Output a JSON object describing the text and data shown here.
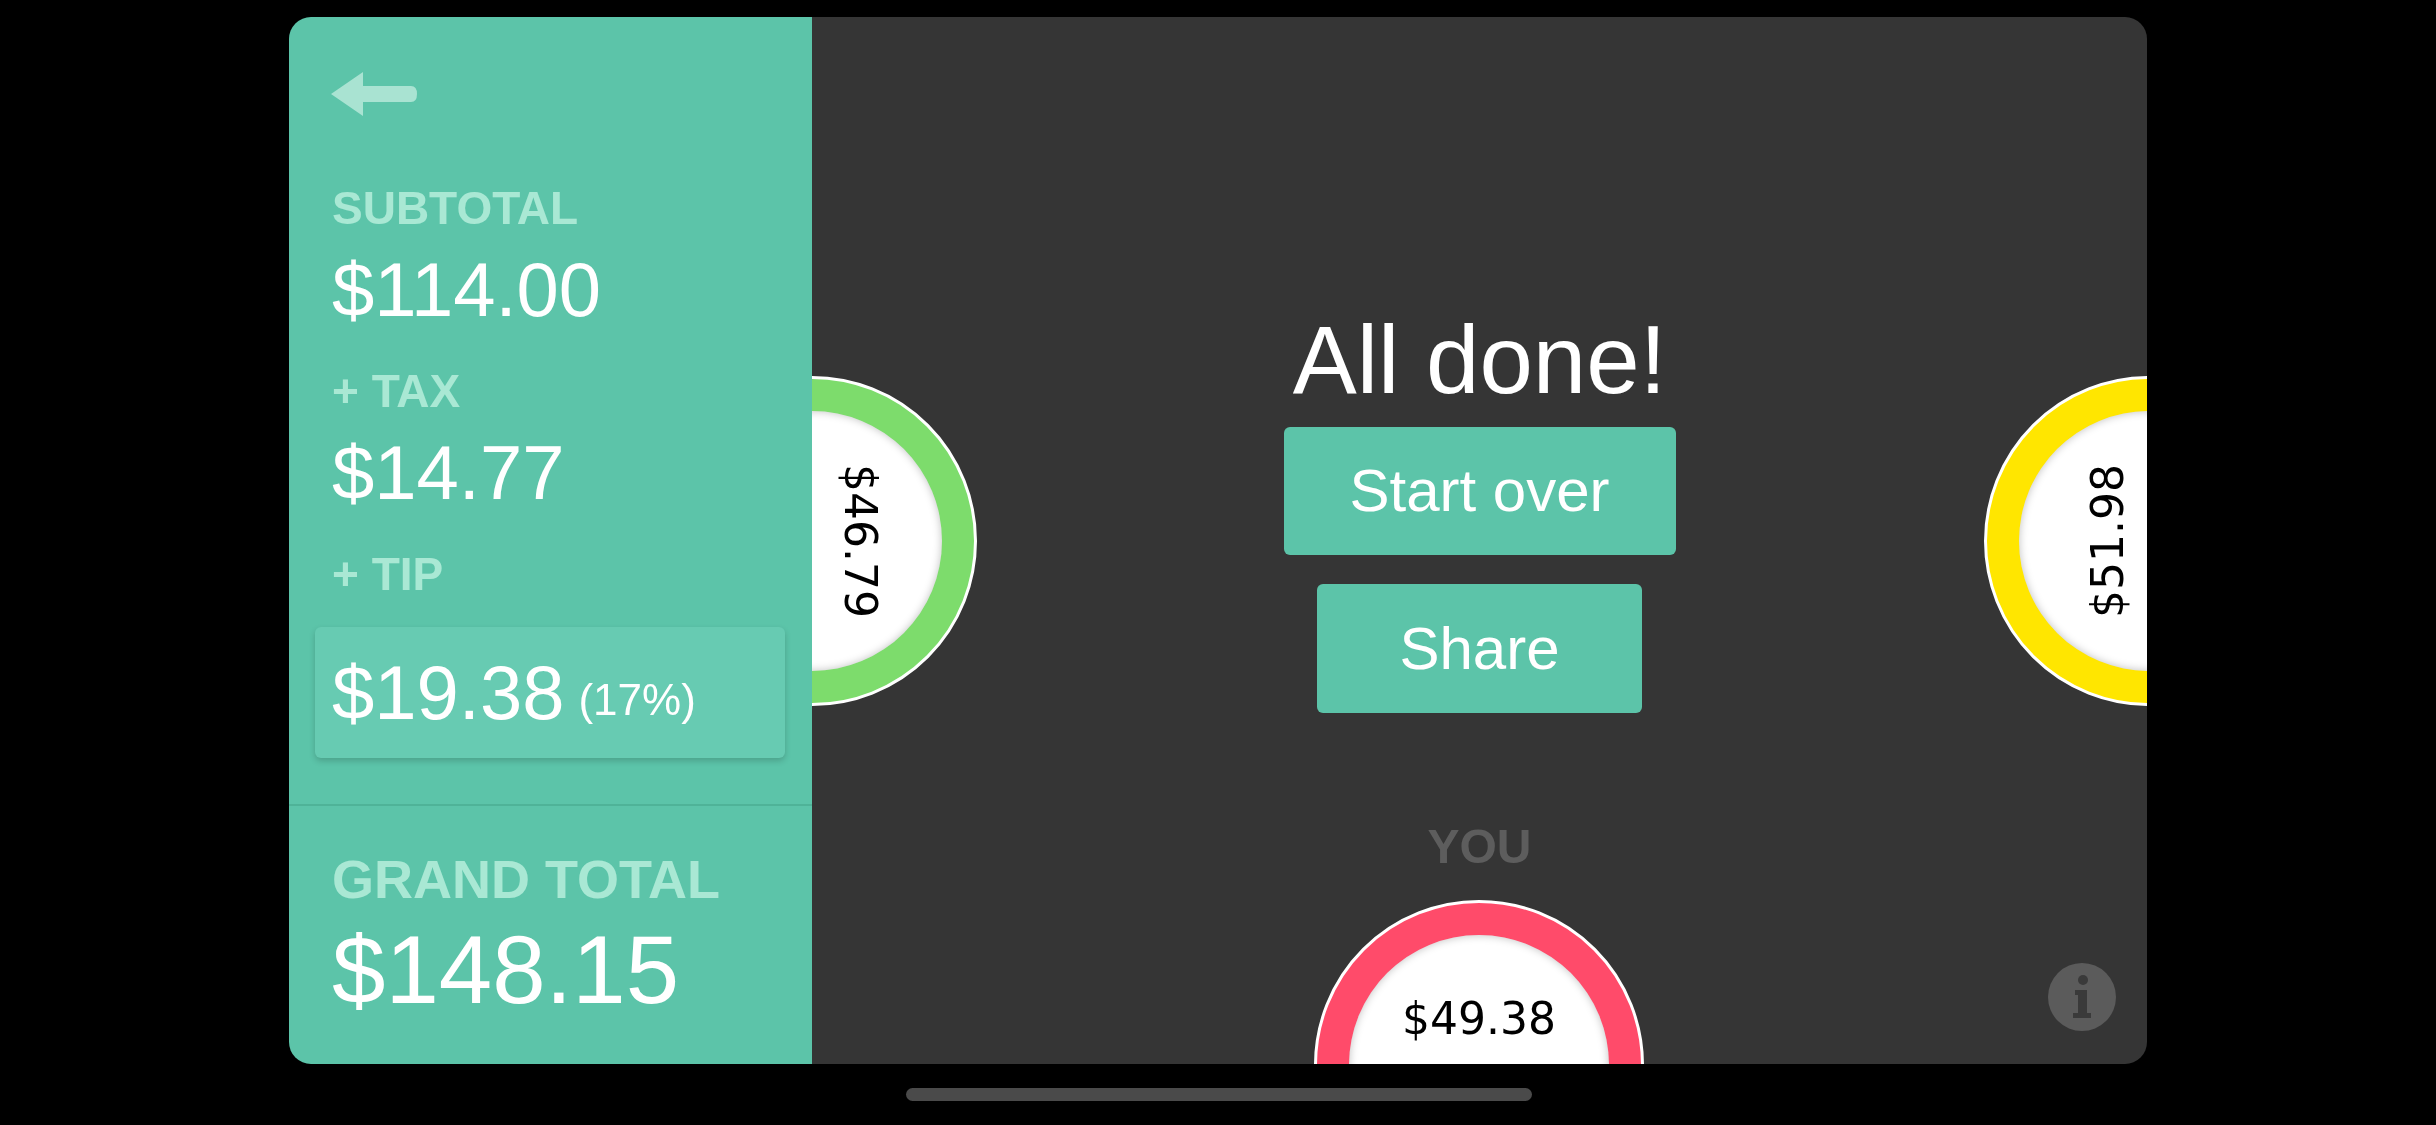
{
  "sidebar": {
    "subtotal": {
      "label": "SUBTOTAL",
      "value": "$114.00"
    },
    "tax": {
      "label": "+ TAX",
      "value": "$14.77"
    },
    "tip": {
      "label": "+ TIP",
      "value": "$19.38",
      "percent": "(17%)"
    },
    "grand_total": {
      "label": "GRAND TOTAL",
      "value": "$148.15"
    }
  },
  "main": {
    "title": "All done!",
    "buttons": [
      "Start over",
      "Share"
    ],
    "you_label": "YOU"
  },
  "people": [
    {
      "kind": "left",
      "amount": "$46.79",
      "color": "#7ddc6c"
    },
    {
      "kind": "right",
      "amount": "$51.98",
      "color": "#ffe600"
    },
    {
      "kind": "bottom",
      "amount": "$49.38",
      "color": "#ff4b6a"
    }
  ]
}
